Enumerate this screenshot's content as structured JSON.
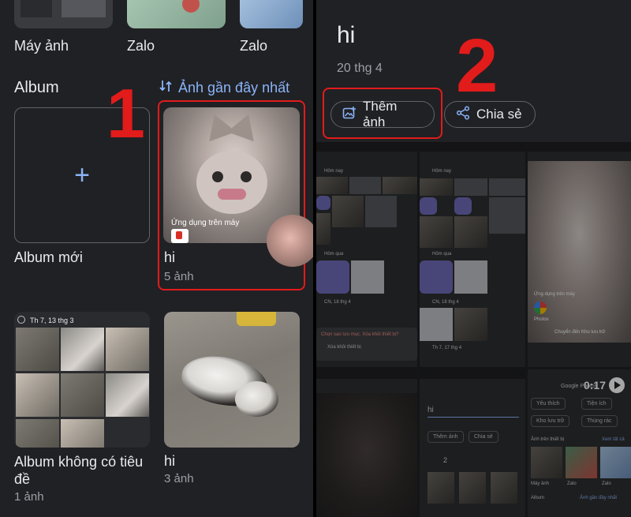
{
  "left": {
    "top_albums": [
      {
        "label": "Máy ảnh"
      },
      {
        "label": "Zalo"
      },
      {
        "label": "Zalo"
      }
    ],
    "section_title": "Album",
    "sort_link": "Ảnh gần đây nhất",
    "new_album_label": "Album mới",
    "albums": [
      {
        "title": "hi",
        "count": "5 ảnh",
        "overlay_text": "Ứng dụng trên máy"
      },
      {
        "title": "Album không có tiêu đề",
        "count": "1 ảnh",
        "date_caption": "Th 7, 13 thg 3"
      },
      {
        "title": "hi",
        "count": "3 ảnh"
      }
    ],
    "step_number": "1"
  },
  "right": {
    "album_title": "hi",
    "album_date": "20 thg 4",
    "add_photo_button": "Thêm ảnh",
    "share_button": "Chia sẻ",
    "step_number": "2",
    "shots": {
      "s1_today": "Hôm nay",
      "s1_yesterday": "Hôm qua",
      "s1_dialog": "Chọn sao lưu mục. Xóa khỏi thiết bị?",
      "s1_delete": "Xóa khỏi thiết bị",
      "s1_date": "CN, 18 thg 4",
      "s2_today": "Hôm nay",
      "s2_yesterday": "Hôm qua",
      "s2_date1": "CN, 18 thg 4",
      "s2_date2": "Th 7, 17 thg 4",
      "s3_app_label": "Ứng dụng trên máy",
      "s3_photos_label": "Photos",
      "s3_move": "Chuyển đến Kho lưu trữ",
      "s5_title": "hi",
      "s5_add": "Thêm ảnh",
      "s5_share": "Chia sẻ",
      "s5_count": "2",
      "s6_app": "Google Photos",
      "s6_time": "0:17",
      "s6_fav": "Yêu thích",
      "s6_util": "Tiện ích",
      "s6_archive": "Kho lưu trữ",
      "s6_trash": "Thùng rác",
      "s6_device": "Ảnh trên thiết bị",
      "s6_see_all": "Xem tất cả",
      "s6_cam": "Máy ảnh",
      "s6_zalo1": "Zalo",
      "s6_zalo2": "Zalo",
      "s6_album": "Album",
      "s6_recent": "Ảnh gần đây nhất"
    }
  },
  "colors": {
    "background": "#202124",
    "accent": "#8ab4f8",
    "highlight_red": "#e21b1b"
  }
}
